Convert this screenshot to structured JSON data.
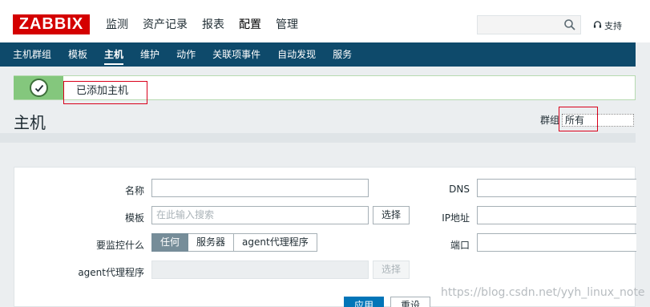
{
  "brand": {
    "logo": "ZABBIX",
    "logo_color": "#d40000"
  },
  "main_menu": [
    "监测",
    "资产记录",
    "报表",
    "配置",
    "管理"
  ],
  "main_menu_active": "配置",
  "search": {
    "value": "",
    "icon": "search-icon"
  },
  "support": {
    "label": "支持",
    "icon": "headset-icon"
  },
  "sub_menu": [
    "主机群组",
    "模板",
    "主机",
    "维护",
    "动作",
    "关联项事件",
    "自动发现",
    "服务"
  ],
  "sub_menu_active": "主机",
  "colors": {
    "nav_bg": "#0e4a6b",
    "success_bg": "#84c77d",
    "primary": "#0275b8",
    "highlight": "#d9001b"
  },
  "message": {
    "text": "已添加主机",
    "icon": "check-circle-icon"
  },
  "page": {
    "title": "主机"
  },
  "group_filter": {
    "label": "群组",
    "selected": "所有"
  },
  "filter": {
    "name_label": "名称",
    "name_value": "",
    "template_label": "模板",
    "template_placeholder": "在此输入搜索",
    "template_select": "选择",
    "monitored_by_label": "要监控什么",
    "monitored_by_options": [
      "任何",
      "服务器",
      "agent代理程序"
    ],
    "monitored_by_selected": "任何",
    "proxy_label": "agent代理程序",
    "proxy_select": "选择",
    "dns_label": "DNS",
    "ip_label": "IP地址",
    "port_label": "端口",
    "apply_label": "应用",
    "reset_label": "重设"
  },
  "watermark": "https://blog.csdn.net/yyh_linux_note"
}
